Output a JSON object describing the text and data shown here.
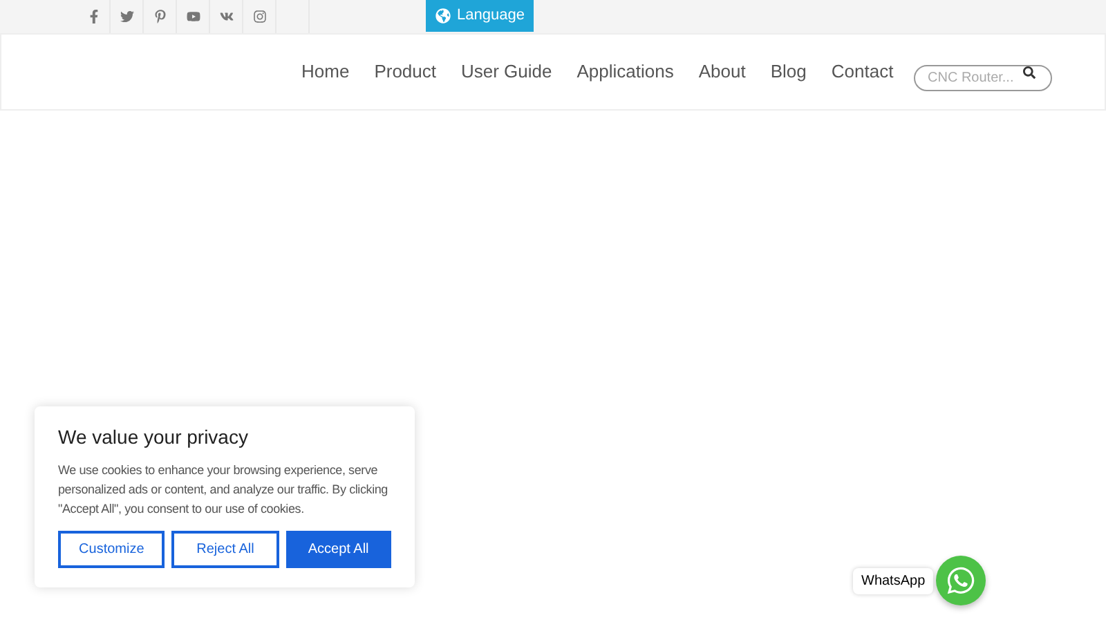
{
  "top_bar": {
    "language_button": "Language"
  },
  "nav": {
    "items": [
      "Home",
      "Product",
      "User Guide",
      "Applications",
      "About",
      "Blog",
      "Contact"
    ]
  },
  "search": {
    "placeholder": "CNC Router..."
  },
  "cookie_banner": {
    "title": "We value your privacy",
    "body": "We use cookies to enhance your browsing experience, serve personalized ads or content, and analyze our traffic. By clicking \"Accept All\", you consent to our use of cookies.",
    "buttons": [
      {
        "label": "Customize",
        "kind": "outline"
      },
      {
        "label": "Reject All",
        "kind": "outline"
      },
      {
        "label": "Accept All",
        "kind": "primary"
      }
    ]
  },
  "whatsapp": {
    "label": "WhatsApp"
  }
}
